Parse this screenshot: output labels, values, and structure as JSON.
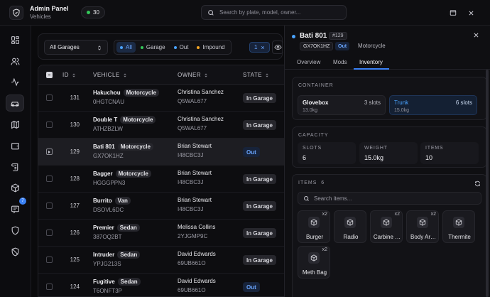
{
  "header": {
    "title": "Admin Panel",
    "subtitle": "Vehicles",
    "online_count": "30",
    "search_placeholder": "Search by plate, model, owner..."
  },
  "sidebar": {
    "items": [
      {
        "name": "dashboard-icon"
      },
      {
        "name": "users-icon"
      },
      {
        "name": "activity-icon"
      },
      {
        "name": "car-icon",
        "active": true
      },
      {
        "name": "map-icon"
      },
      {
        "name": "wallet-icon"
      },
      {
        "name": "scroll-icon"
      },
      {
        "name": "package-icon"
      },
      {
        "name": "chat-icon",
        "badge": "7"
      },
      {
        "name": "shield-icon"
      },
      {
        "name": "shield-off-icon"
      }
    ]
  },
  "filters": {
    "garage_select": "All Garages",
    "chips": [
      {
        "label": "All",
        "color": "#4aa3ff",
        "active": true
      },
      {
        "label": "Garage",
        "color": "#34c759"
      },
      {
        "label": "Out",
        "color": "#4aa3ff"
      },
      {
        "label": "Impound",
        "color": "#f5a623"
      }
    ],
    "selected_count": "1"
  },
  "table": {
    "headers": {
      "id": "ID",
      "vehicle": "VEHICLE",
      "owner": "OWNER",
      "state": "STATE"
    },
    "rows": [
      {
        "id": "131",
        "name": "Hakuchou",
        "type": "Motorcycle",
        "plate": "0HGTCNAU",
        "owner": "Christina Sanchez",
        "owner_id": "Q5WAL677",
        "state": "In Garage"
      },
      {
        "id": "130",
        "name": "Double T",
        "type": "Motorcycle",
        "plate": "ATHZBZLW",
        "owner": "Christina Sanchez",
        "owner_id": "Q5WAL677",
        "state": "In Garage"
      },
      {
        "id": "129",
        "name": "Bati 801",
        "type": "Motorcycle",
        "plate": "GX7OK1HZ",
        "owner": "Brian Stewart",
        "owner_id": "I48CBC3J",
        "state": "Out",
        "selected": true
      },
      {
        "id": "128",
        "name": "Bagger",
        "type": "Motorcycle",
        "plate": "HGGGPPN3",
        "owner": "Brian Stewart",
        "owner_id": "I48CBC3J",
        "state": "In Garage"
      },
      {
        "id": "127",
        "name": "Burrito",
        "type": "Van",
        "plate": "DSOVL6DC",
        "owner": "Brian Stewart",
        "owner_id": "I48CBC3J",
        "state": "In Garage"
      },
      {
        "id": "126",
        "name": "Premier",
        "type": "Sedan",
        "plate": "387OQ2BT",
        "owner": "Melissa Collins",
        "owner_id": "2YJGMP9C",
        "state": "In Garage"
      },
      {
        "id": "125",
        "name": "Intruder",
        "type": "Sedan",
        "plate": "YPJG213S",
        "owner": "David Edwards",
        "owner_id": "69UB661O",
        "state": "In Garage"
      },
      {
        "id": "124",
        "name": "Fugitive",
        "type": "Sedan",
        "plate": "T6ONFT3P",
        "owner": "David Edwards",
        "owner_id": "69UB661O",
        "state": "Out"
      }
    ]
  },
  "panel": {
    "title": "Bati 801",
    "id_tag": "#129",
    "plate": "GX7OK1HZ",
    "status": "Out",
    "type": "Motorcycle",
    "tabs": [
      "Overview",
      "Mods",
      "Inventory"
    ],
    "active_tab": "Inventory",
    "container": {
      "label": "CONTAINER",
      "boxes": [
        {
          "name": "Glovebox",
          "slots": "3 slots",
          "weight": "13.0kg"
        },
        {
          "name": "Trunk",
          "slots": "6 slots",
          "weight": "15.0kg",
          "active": true
        }
      ]
    },
    "capacity": {
      "label": "CAPACITY",
      "stats": [
        {
          "label": "SLOTS",
          "value": "6"
        },
        {
          "label": "WEIGHT",
          "value": "15.0kg"
        },
        {
          "label": "ITEMS",
          "value": "10"
        }
      ]
    },
    "items": {
      "label": "ITEMS",
      "count": "6",
      "search_placeholder": "Search items...",
      "list": [
        {
          "name": "Burger",
          "qty": "x2"
        },
        {
          "name": "Radio",
          "qty": ""
        },
        {
          "name": "Carbine …",
          "qty": "x2"
        },
        {
          "name": "Body Ar…",
          "qty": "x2"
        },
        {
          "name": "Thermite",
          "qty": ""
        },
        {
          "name": "Meth Bag",
          "qty": "x2"
        }
      ]
    }
  }
}
